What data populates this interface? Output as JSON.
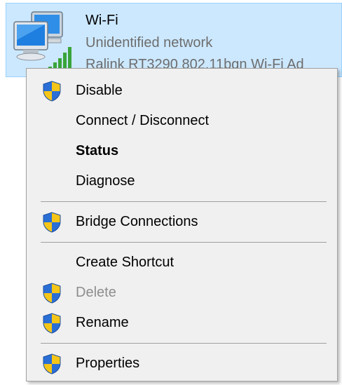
{
  "network": {
    "name": "Wi-Fi",
    "status": "Unidentified network",
    "adapter": "Ralink RT3290 802.11bgn Wi-Fi Ad",
    "icon": "network-computers-icon",
    "signal_icon": "signal-bars-icon"
  },
  "menu": {
    "items": [
      {
        "label": "Disable",
        "shield": true,
        "bold": false,
        "enabled": true
      },
      {
        "label": "Connect / Disconnect",
        "shield": false,
        "bold": false,
        "enabled": true
      },
      {
        "label": "Status",
        "shield": false,
        "bold": true,
        "enabled": true
      },
      {
        "label": "Diagnose",
        "shield": false,
        "bold": false,
        "enabled": true
      },
      {
        "label": "Bridge Connections",
        "shield": true,
        "bold": false,
        "enabled": true
      },
      {
        "label": "Create Shortcut",
        "shield": false,
        "bold": false,
        "enabled": true
      },
      {
        "label": "Delete",
        "shield": true,
        "bold": false,
        "enabled": false
      },
      {
        "label": "Rename",
        "shield": true,
        "bold": false,
        "enabled": true
      },
      {
        "label": "Properties",
        "shield": true,
        "bold": false,
        "enabled": true
      }
    ]
  },
  "colors": {
    "selection_bg": "#cce8ff",
    "selection_border": "#99d1ff",
    "menu_bg": "#f0f0f0",
    "disabled_text": "#8d8d8d",
    "secondary_text": "#6d6d6d",
    "shield_blue": "#2a6fd6",
    "shield_yellow": "#f5c518",
    "signal_green": "#3aa43a"
  }
}
